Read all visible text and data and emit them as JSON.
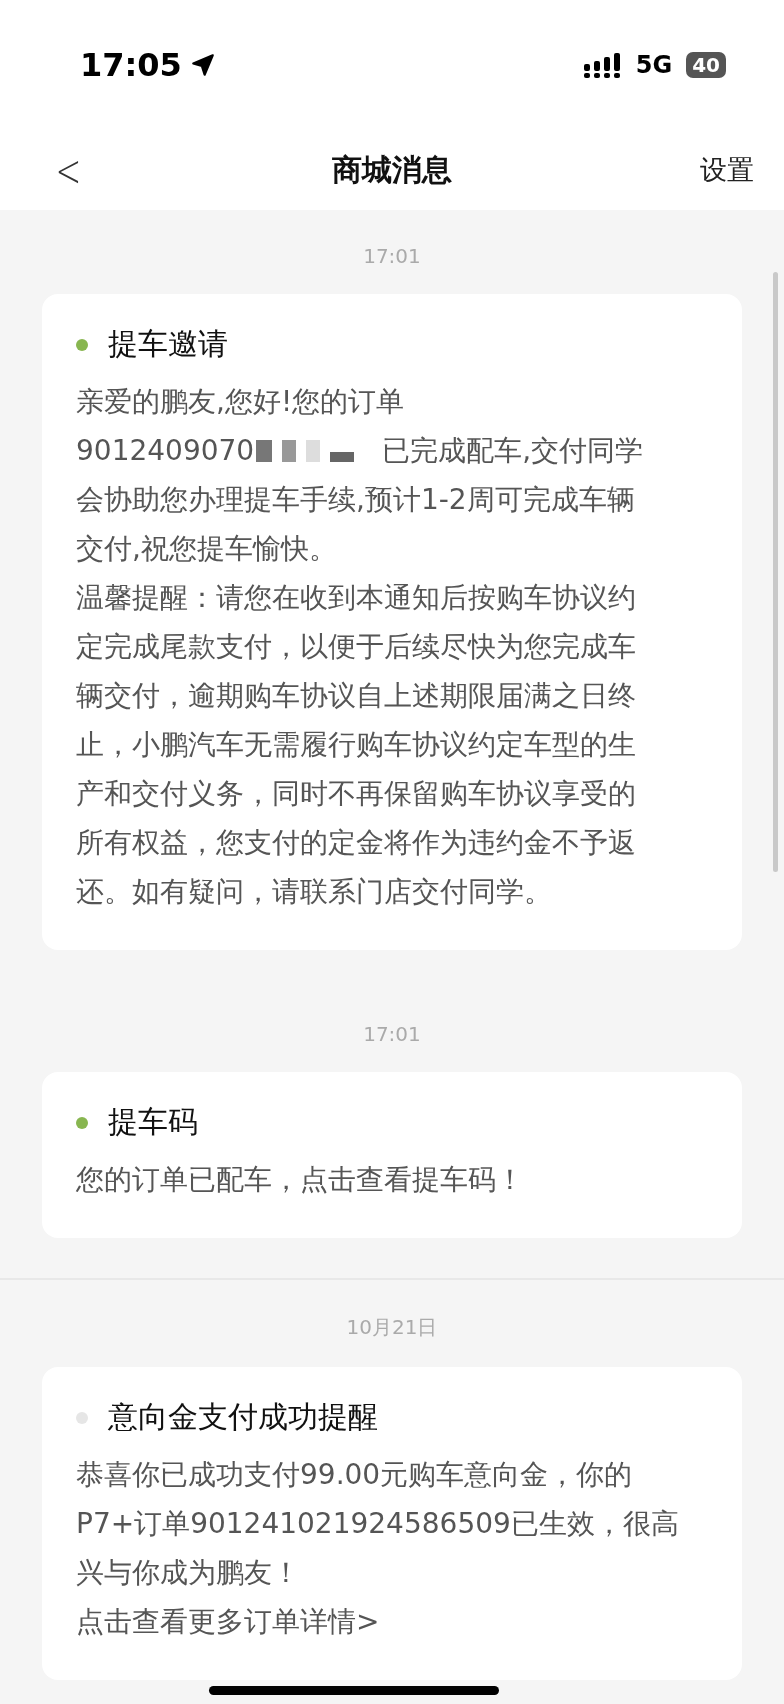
{
  "status_bar": {
    "time": "17:05",
    "network": "5G",
    "battery": "40"
  },
  "nav": {
    "back": "<",
    "title": "商城消息",
    "action": "设置"
  },
  "sections": [
    {
      "kind": "message",
      "time": "17:01",
      "card": {
        "unread": true,
        "title": "提车邀请",
        "lines": [
          [
            "亲爱的鹏友,您好!您的订单"
          ],
          [
            "9012409070",
            "已完成配车,交付同学"
          ],
          [
            "会协助您办理提车手续,预计1-2周可完成车辆"
          ],
          [
            "交付,祝您提车愉快。"
          ],
          [
            "温馨提醒：请您在收到本通知后按购车协议约"
          ],
          [
            "定完成尾款支付，以便于后续尽快为您完成车"
          ],
          [
            "辆交付，逾期购车协议自上述期限届满之日终"
          ],
          [
            "止，小鹏汽车无需履行购车协议约定车型的生"
          ],
          [
            "产和交付义务，同时不再保留购车协议享受的"
          ],
          [
            "所有权益，您支付的定金将作为违约金不予返"
          ],
          [
            "还。如有疑问，请联系门店交付同学。"
          ]
        ]
      }
    },
    {
      "kind": "message",
      "time": "17:01",
      "card": {
        "unread": true,
        "title": "提车码",
        "lines": [
          [
            "您的订单已配车，点击查看提车码！"
          ]
        ]
      }
    },
    {
      "kind": "divider"
    },
    {
      "kind": "message",
      "time": "10月21日",
      "card": {
        "unread": false,
        "title": "意向金支付成功提醒",
        "lines": [
          [
            "恭喜你已成功支付99.00元购车意向金，你的"
          ],
          [
            "P7+订单901241021924586509已生效，很高"
          ],
          [
            "兴与你成为鹏友！"
          ],
          [
            "点击查看更多订单详情>"
          ]
        ]
      }
    }
  ]
}
